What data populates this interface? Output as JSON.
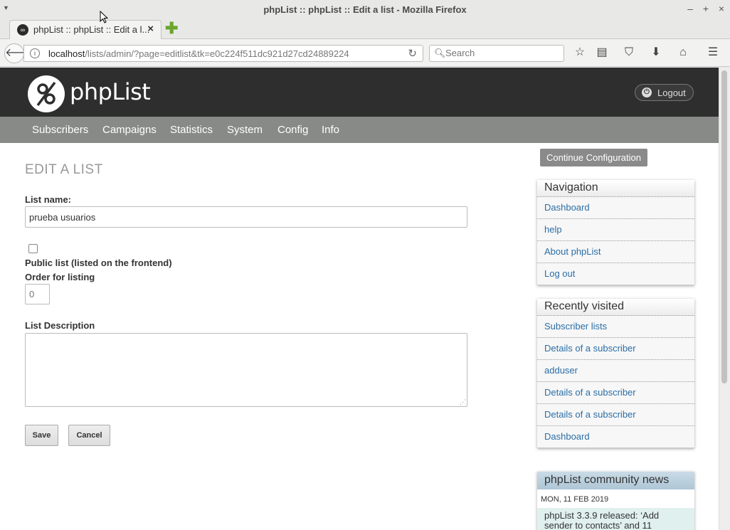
{
  "window": {
    "title": "phpList :: phpList :: Edit a list - Mozilla Firefox",
    "controls": [
      "–",
      "+",
      "×"
    ]
  },
  "tabs": [
    {
      "label": "phpList :: phpList :: Edit a l...",
      "close": "×"
    }
  ],
  "newtab": "✚",
  "navbar": {
    "url_host": "localhost",
    "url_path": "/lists/admin/?page=editlist&tk=e0c224f511dc921d27cd24889224",
    "search_placeholder": "Search"
  },
  "header": {
    "logo_text": "phpList",
    "logout_label": "Logout"
  },
  "mainnav": [
    "Subscribers",
    "Campaigns",
    "Statistics",
    "System",
    "Config",
    "Info"
  ],
  "form": {
    "heading": "EDIT A LIST",
    "list_name_label": "List name:",
    "list_name_value": "prueba usuarios",
    "public_label": "Public list (listed on the frontend)",
    "public_checked": false,
    "order_label": "Order for listing",
    "order_placeholder": "0",
    "description_label": "List Description",
    "description_value": "",
    "save_label": "Save",
    "cancel_label": "Cancel"
  },
  "sidebar": {
    "continue_label": "Continue Configuration",
    "navigation": {
      "title": "Navigation",
      "items": [
        "Dashboard",
        "help",
        "About phpList",
        "Log out"
      ]
    },
    "recent": {
      "title": "Recently visited",
      "items": [
        "Subscriber lists",
        "Details of a subscriber",
        "adduser",
        "Details of a subscriber",
        "Details of a subscriber",
        "Dashboard"
      ]
    },
    "news": {
      "title": "phpList community news",
      "date": "MON, 11 FEB 2019",
      "headline": "phpList 3.3.9 released: ‘Add sender to contacts’ and 11"
    }
  },
  "colors": {
    "header_bg": "#2e2e2e",
    "nav_bg": "#888a88",
    "link": "#2a6ea6",
    "news_head": "#aec6d6"
  }
}
